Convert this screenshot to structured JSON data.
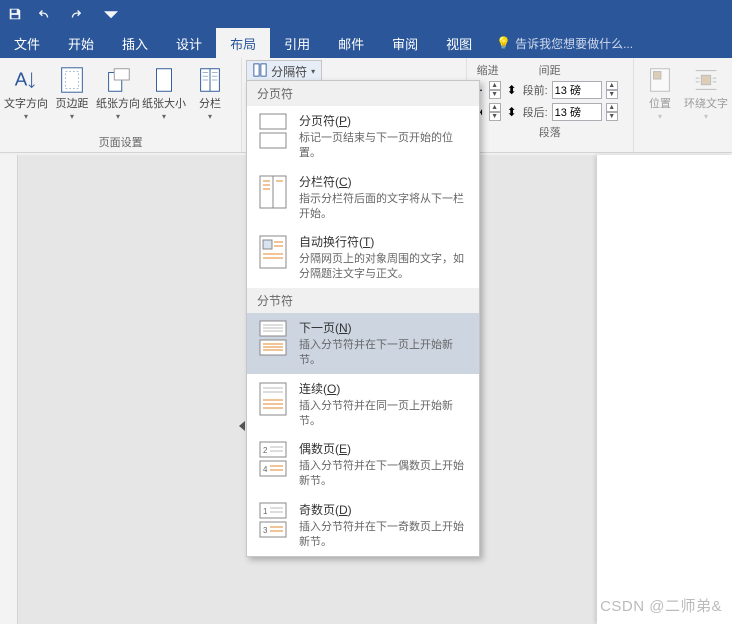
{
  "qat": {
    "save": "保存",
    "undo": "撤销",
    "redo": "重做"
  },
  "tabs": {
    "file": "文件",
    "home": "开始",
    "insert": "插入",
    "design": "设计",
    "layout": "布局",
    "references": "引用",
    "mailings": "邮件",
    "review": "审阅",
    "view": "视图",
    "tellme_placeholder": "告诉我您想要做什么..."
  },
  "ribbon": {
    "page_setup": {
      "label": "页面设置",
      "text_direction": "文字方向",
      "margins": "页边距",
      "orientation": "纸张方向",
      "size": "纸张大小",
      "columns": "分栏"
    },
    "breaks": {
      "label": "分隔符"
    },
    "line_numbers_placeholder": "",
    "paragraph": {
      "label": "段落",
      "indent_header": "缩进",
      "spacing_header": "间距",
      "before_label": "段前:",
      "after_label": "段后:",
      "before_value": "13 磅",
      "after_value": "13 磅"
    },
    "arrange": {
      "position": "位置",
      "wrap": "环绕文字"
    }
  },
  "dropdown": {
    "page_breaks_header": "分页符",
    "section_breaks_header": "分节符",
    "items": {
      "page_break": {
        "title": "分页符(",
        "mn": "P",
        "title2": ")",
        "desc": "标记一页结束与下一页开始的位置。"
      },
      "column_break": {
        "title": "分栏符(",
        "mn": "C",
        "title2": ")",
        "desc": "指示分栏符后面的文字将从下一栏开始。"
      },
      "text_wrapping": {
        "title": "自动换行符(",
        "mn": "T",
        "title2": ")",
        "desc": "分隔网页上的对象周围的文字，如分隔题注文字与正文。"
      },
      "next_page": {
        "title": "下一页(",
        "mn": "N",
        "title2": ")",
        "desc": "插入分节符并在下一页上开始新节。"
      },
      "continuous": {
        "title": "连续(",
        "mn": "O",
        "title2": ")",
        "desc": "插入分节符并在同一页上开始新节。"
      },
      "even_page": {
        "title": "偶数页(",
        "mn": "E",
        "title2": ")",
        "desc": "插入分节符并在下一偶数页上开始新节。"
      },
      "odd_page": {
        "title": "奇数页(",
        "mn": "D",
        "title2": ")",
        "desc": "插入分节符并在下一奇数页上开始新节。"
      }
    }
  },
  "watermark": "CSDN @二师弟&"
}
